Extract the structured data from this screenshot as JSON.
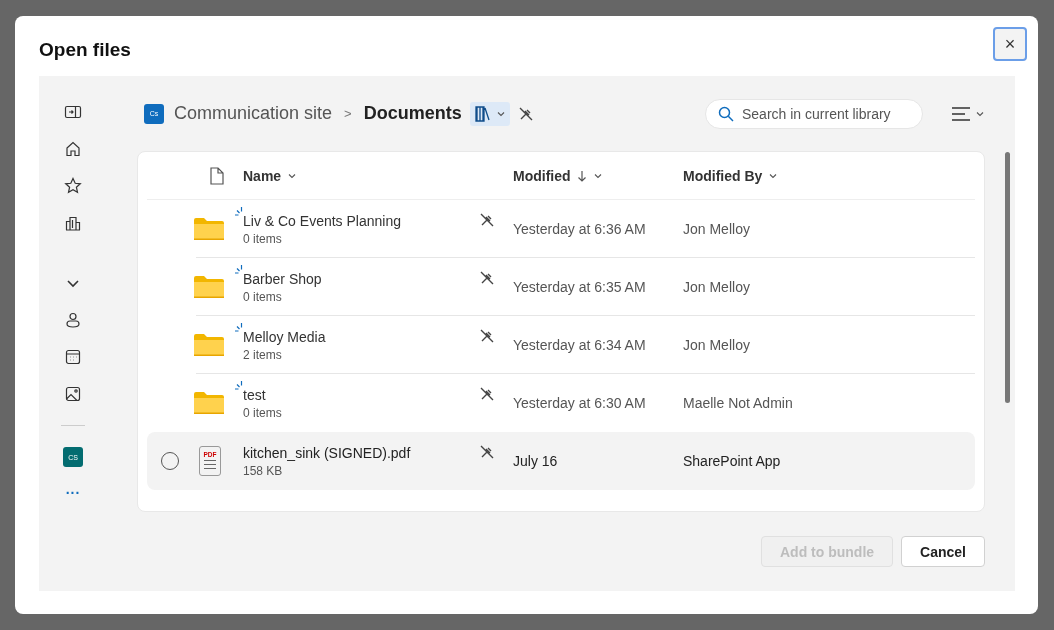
{
  "dialog": {
    "title": "Open files",
    "close_label": "×"
  },
  "rail": {
    "site_tile": "CS",
    "more": "..."
  },
  "breadcrumb": {
    "site_tile": "Cs",
    "site": "Communication site",
    "separator": ">",
    "library": "Documents"
  },
  "search": {
    "placeholder": "Search in current library"
  },
  "table": {
    "columns": [
      {
        "label": "Name",
        "sorted_descending": false
      },
      {
        "label": "Modified",
        "sorted_descending": true
      },
      {
        "label": "Modified By",
        "sorted_descending": false
      }
    ],
    "rows": [
      {
        "kind": "folder",
        "name": "Liv & Co Events Planning",
        "meta": "0 items",
        "modified": "Yesterday at 6:36 AM",
        "modified_by": "Jon Melloy",
        "new": true,
        "hovered": false
      },
      {
        "kind": "folder",
        "name": "Barber Shop",
        "meta": "0 items",
        "modified": "Yesterday at 6:35 AM",
        "modified_by": "Jon Melloy",
        "new": true,
        "hovered": false
      },
      {
        "kind": "folder",
        "name": "Melloy Media",
        "meta": "2 items",
        "modified": "Yesterday at 6:34 AM",
        "modified_by": "Jon Melloy",
        "new": true,
        "hovered": false
      },
      {
        "kind": "folder",
        "name": "test",
        "meta": "0 items",
        "modified": "Yesterday at 6:30 AM",
        "modified_by": "Maelle Not Admin",
        "new": true,
        "hovered": false
      },
      {
        "kind": "pdf",
        "badge": "PDF",
        "name": "kitchen_sink (SIGNED).pdf",
        "meta": "158 KB",
        "modified": "July 16",
        "modified_by": "SharePoint App",
        "new": false,
        "hovered": true
      }
    ]
  },
  "buttons": [
    {
      "label": "Add to bundle",
      "disabled": true
    },
    {
      "label": "Cancel",
      "disabled": false
    }
  ]
}
